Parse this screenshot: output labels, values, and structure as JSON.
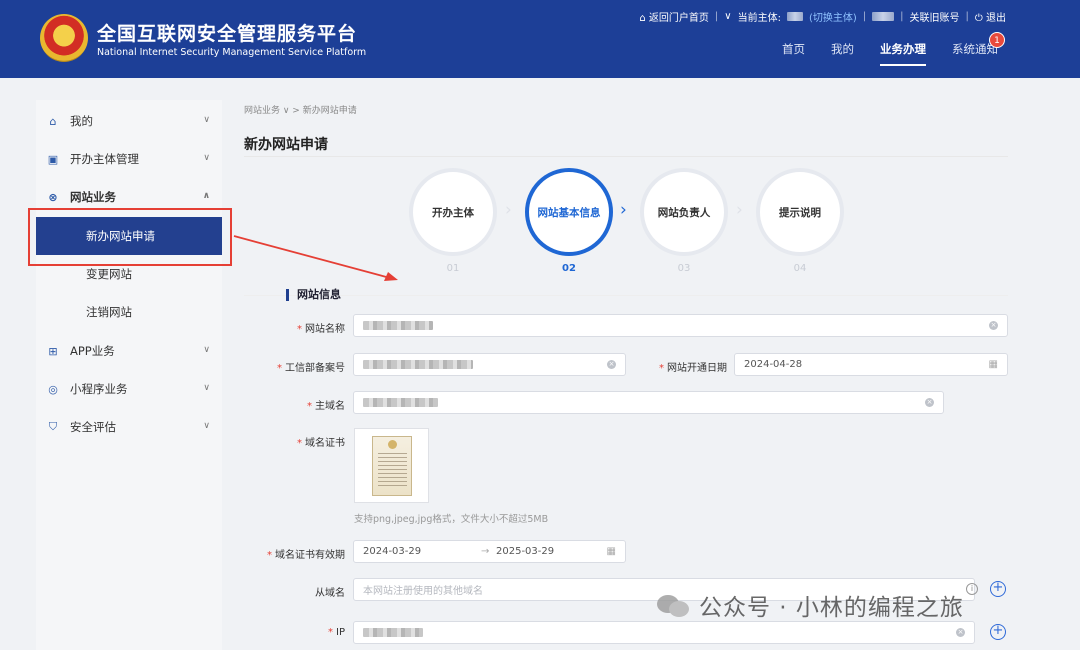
{
  "header": {
    "title_cn": "全国互联网安全管理服务平台",
    "title_en": "National Internet Security Management Service Platform",
    "top_links": {
      "back": "⌂ 返回门户首页",
      "current": "当前主体:",
      "switch": "(切换主体)",
      "associate": "关联旧账号",
      "logout": "退出"
    },
    "nav": [
      "首页",
      "我的",
      "业务办理",
      "系统通知"
    ],
    "notification_count": "1"
  },
  "sidebar": {
    "items": [
      {
        "label": "我的",
        "icon": "home-icon"
      },
      {
        "label": "开办主体管理",
        "icon": "briefcase-icon"
      },
      {
        "label": "网站业务",
        "icon": "globe-icon"
      },
      {
        "label": "APP业务",
        "icon": "grid-icon"
      },
      {
        "label": "小程序业务",
        "icon": "compass-icon"
      },
      {
        "label": "安全评估",
        "icon": "shield-icon"
      }
    ],
    "sub_items": [
      "新办网站申请",
      "变更网站",
      "注销网站"
    ]
  },
  "breadcrumb": "网站业务 ∨ > 新办网站申请",
  "page_title": "新办网站申请",
  "steps": [
    {
      "label": "开办主体",
      "num": "01"
    },
    {
      "label": "网站基本信息",
      "num": "02"
    },
    {
      "label": "网站负责人",
      "num": "03"
    },
    {
      "label": "提示说明",
      "num": "04"
    }
  ],
  "section_title": "网站信息",
  "form": {
    "site_name_label": "网站名称",
    "icp_label": "工信部备案号",
    "open_date_label": "网站开通日期",
    "open_date": "2024-04-28",
    "main_domain_label": "主域名",
    "cert_label": "域名证书",
    "cert_hint": "支持png,jpeg,jpg格式，文件大小不超过5MB",
    "validity_label": "域名证书有效期",
    "validity_start": "2024-03-29",
    "validity_arrow": "→",
    "validity_end": "2025-03-29",
    "sub_domain_label": "从域名",
    "sub_domain_placeholder": "本网站注册使用的其他域名",
    "ip_label": "IP"
  },
  "watermark": "公众号 · 小林的编程之旅",
  "colors": {
    "header": "#1d3f97",
    "accent": "#1f67d4",
    "sidebar_active": "#23408f",
    "annotation": "#e53f35"
  }
}
